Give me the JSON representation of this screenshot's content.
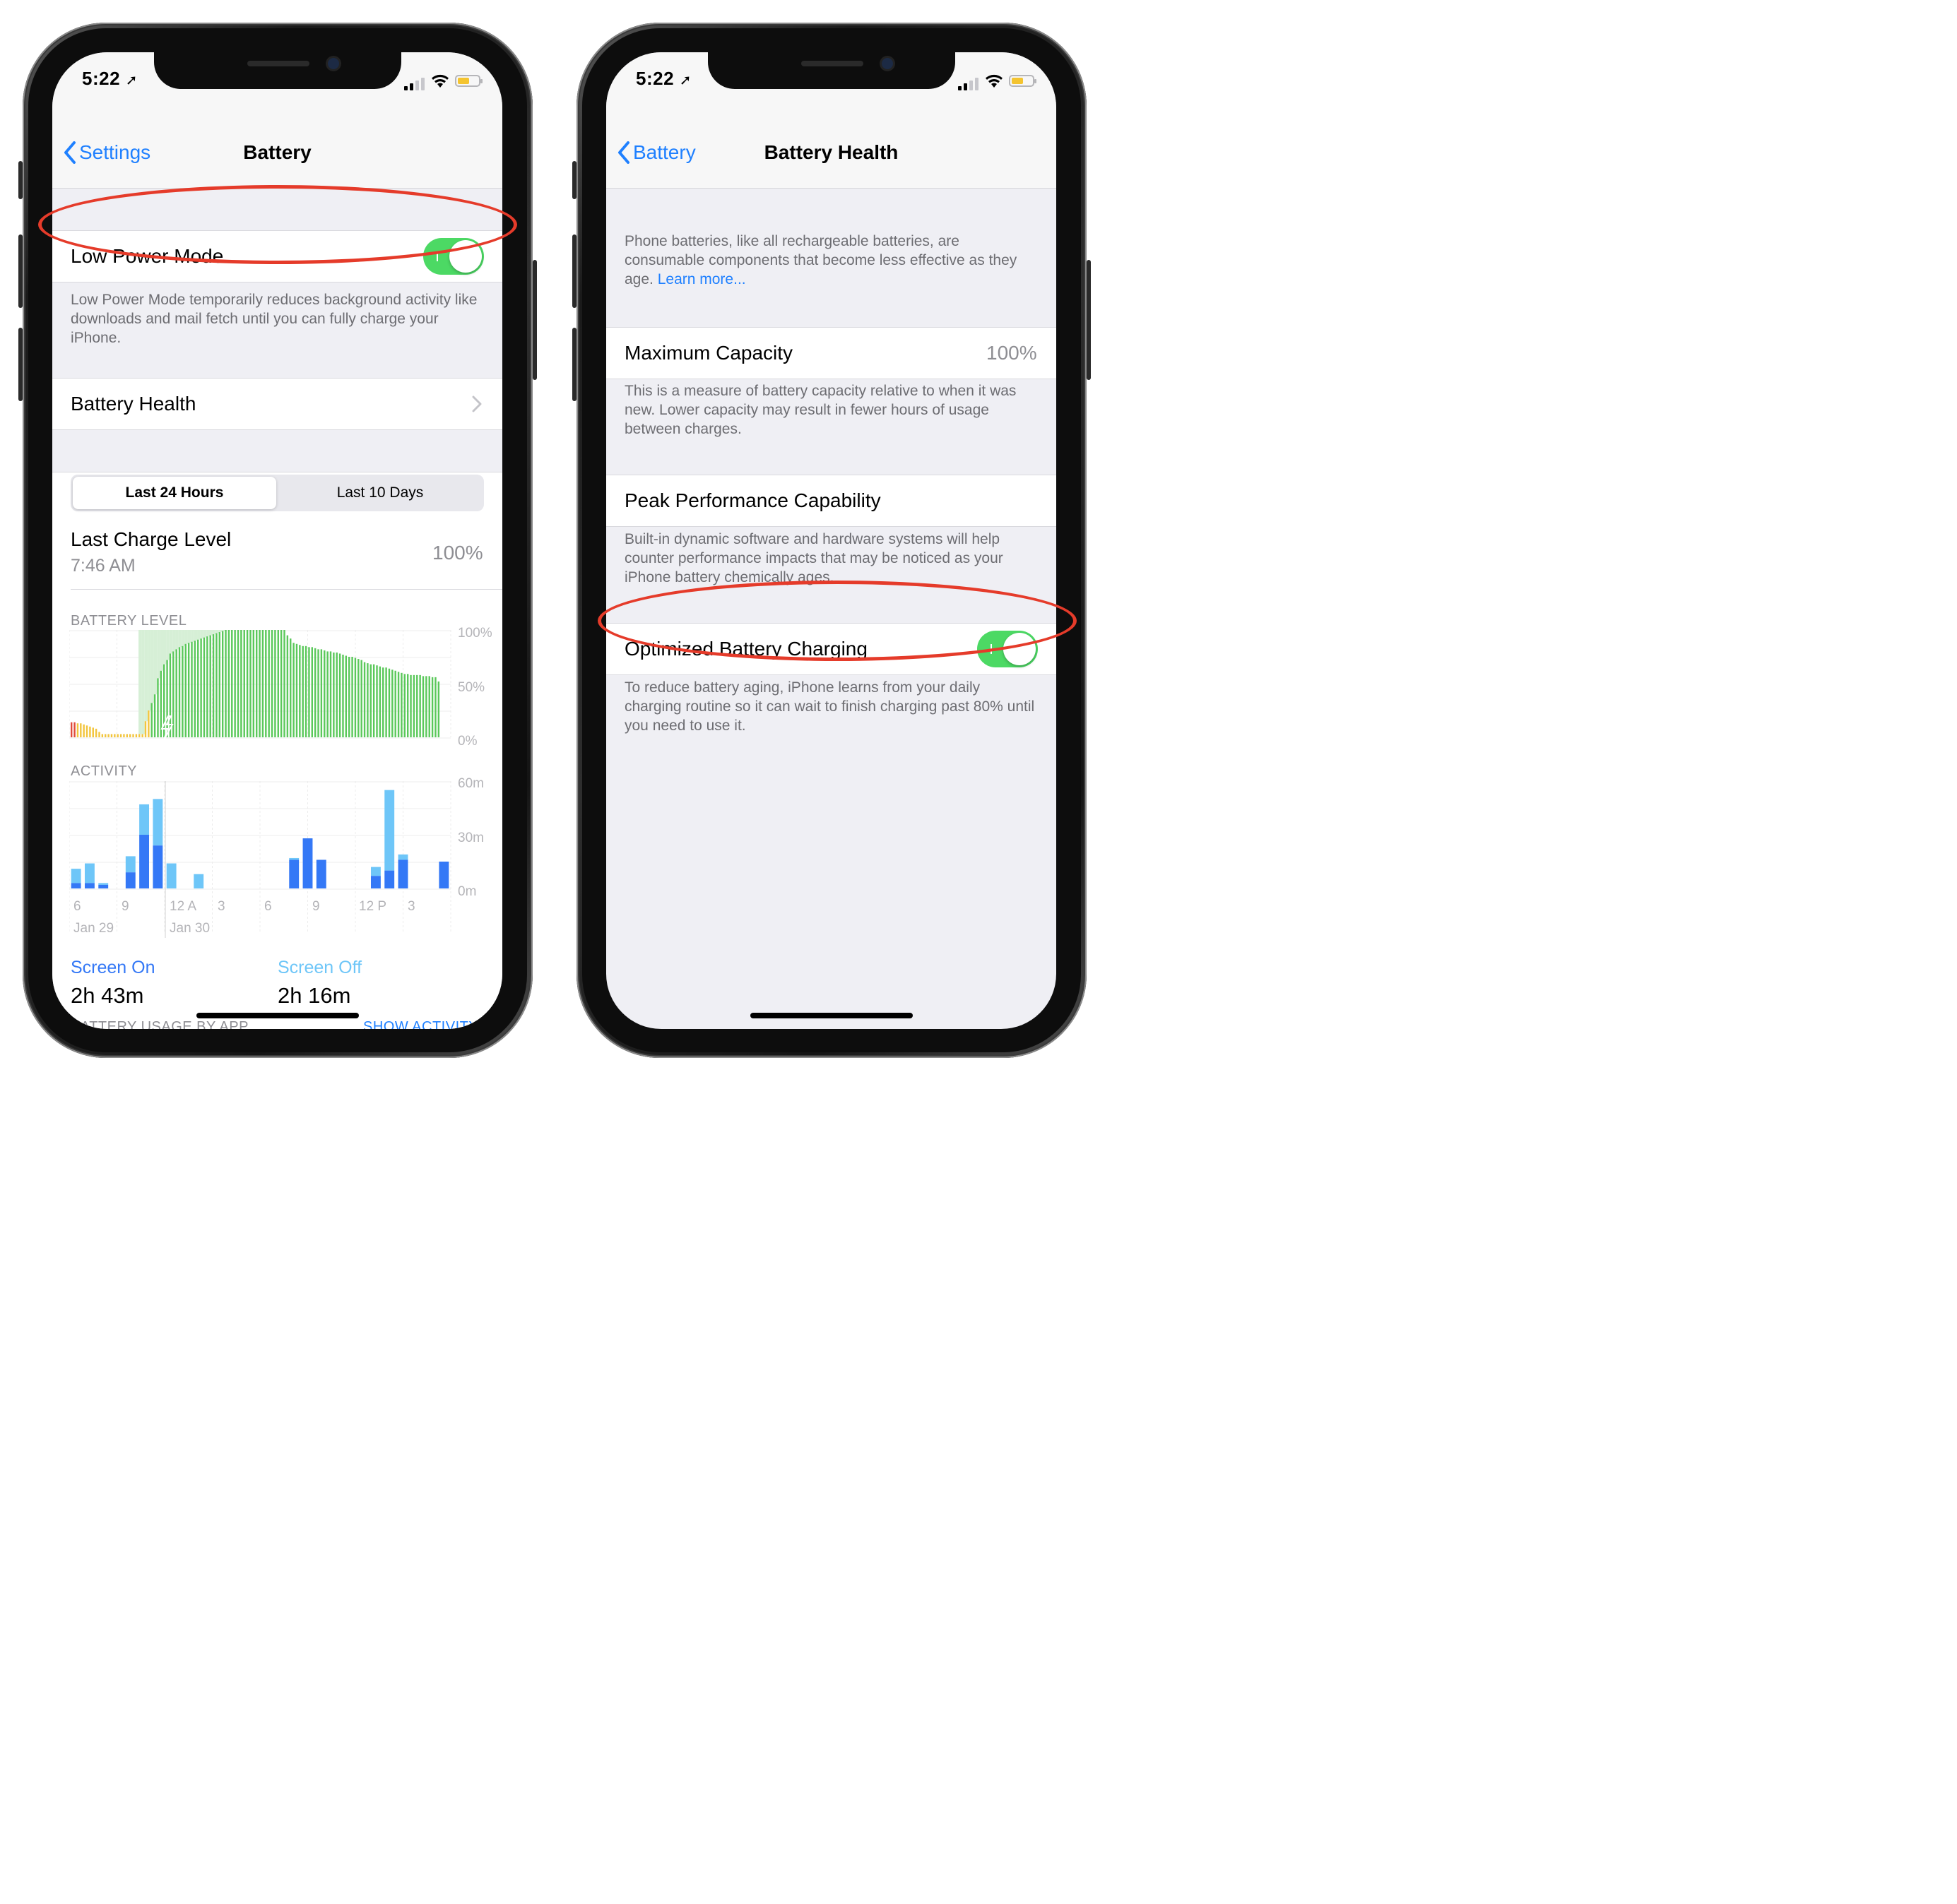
{
  "status": {
    "time": "5:22"
  },
  "colors": {
    "accent": "#1f80ff",
    "toggle_on": "#4cd964",
    "annotation": "#e53b2a",
    "screen_on": "#3478f6",
    "screen_off": "#6ec6f8",
    "battery_green": "#5ac85a",
    "battery_yellow": "#f2c53d",
    "battery_red": "#e04a3a"
  },
  "left": {
    "back_label": "Settings",
    "title": "Battery",
    "low_power": {
      "label": "Low Power Mode",
      "enabled": true,
      "footnote": "Low Power Mode temporarily reduces background activity like downloads and mail fetch until you can fully charge your iPhone."
    },
    "battery_health_label": "Battery Health",
    "segments": [
      "Last 24 Hours",
      "Last 10 Days"
    ],
    "last_charge": {
      "label": "Last Charge Level",
      "time": "7:46 AM",
      "value": "100%"
    },
    "battery_level_title": "BATTERY LEVEL",
    "battery_axis": [
      "100%",
      "50%",
      "0%"
    ],
    "activity_title": "ACTIVITY",
    "activity_axis": [
      "60m",
      "30m",
      "0m"
    ],
    "x_ticks": [
      "6",
      "9",
      "12 A",
      "3",
      "6",
      "9",
      "12 P",
      "3"
    ],
    "x_dates": [
      "Jan 29",
      "Jan 30"
    ],
    "screen_on": {
      "label": "Screen On",
      "value": "2h 43m"
    },
    "screen_off": {
      "label": "Screen Off",
      "value": "2h 16m"
    },
    "usage_header": "BATTERY USAGE BY APP",
    "show_activity": "SHOW ACTIVITY"
  },
  "right": {
    "back_label": "Battery",
    "title": "Battery Health",
    "intro": "Phone batteries, like all rechargeable batteries, are consumable components that become less effective as they age.",
    "learn_more": "Learn more...",
    "max_capacity": {
      "label": "Maximum Capacity",
      "value": "100%",
      "footnote": "This is a measure of battery capacity relative to when it was new. Lower capacity may result in fewer hours of usage between charges."
    },
    "peak": {
      "label": "Peak Performance Capability",
      "footnote": "Built-in dynamic software and hardware systems will help counter performance impacts that may be noticed as your iPhone battery chemically ages."
    },
    "optimized": {
      "label": "Optimized Battery Charging",
      "enabled": true,
      "footnote": "To reduce battery aging, iPhone learns from your daily charging routine so it can wait to finish charging past 80% until you need to use it."
    }
  },
  "chart_data": [
    {
      "type": "bar",
      "title": "BATTERY LEVEL",
      "ylabel": "",
      "ylim": [
        0,
        100
      ],
      "y_ticks": [
        "0%",
        "50%",
        "100%"
      ],
      "x_ticks": [
        "6",
        "9",
        "12 A",
        "3",
        "6",
        "9",
        "12 P",
        "3"
      ],
      "x_dates": [
        "Jan 29",
        "Jan 30"
      ],
      "series": [
        {
          "values": [
            14,
            14,
            13,
            13,
            12,
            11,
            10,
            9,
            8,
            5,
            3,
            3,
            3,
            3,
            3,
            3,
            3,
            3,
            3,
            3,
            3,
            3,
            3,
            3,
            15,
            25,
            32,
            40,
            55,
            62,
            68,
            72,
            78,
            80,
            82,
            84,
            85,
            87,
            88,
            89,
            90,
            91,
            92,
            93,
            94,
            95,
            96,
            97,
            98,
            99,
            100,
            100,
            100,
            100,
            100,
            100,
            100,
            100,
            100,
            100,
            100,
            100,
            100,
            100,
            100,
            100,
            100,
            100,
            100,
            100,
            95,
            92,
            88,
            87,
            86,
            85,
            85,
            84,
            84,
            83,
            82,
            82,
            81,
            80,
            80,
            79,
            79,
            78,
            77,
            76,
            75,
            75,
            74,
            73,
            72,
            70,
            69,
            68,
            68,
            67,
            66,
            65,
            65,
            64,
            63,
            62,
            61,
            60,
            59,
            59,
            58,
            58,
            58,
            58,
            57,
            57,
            57,
            56,
            56,
            52
          ]
        }
      ]
    },
    {
      "type": "bar",
      "title": "ACTIVITY",
      "ylabel": "",
      "ylim": [
        0,
        60
      ],
      "y_ticks": [
        "0m",
        "30m",
        "60m"
      ],
      "x_ticks": [
        "6",
        "9",
        "12 A",
        "3",
        "6",
        "9",
        "12 P",
        "3"
      ],
      "x_dates": [
        "Jan 29",
        "Jan 30"
      ],
      "series": [
        {
          "name": "Screen On",
          "values": [
            3,
            3,
            2,
            0,
            9,
            30,
            24,
            0,
            0,
            0,
            0,
            0,
            0,
            0,
            0,
            0,
            16,
            28,
            16,
            0,
            0,
            0,
            7,
            10,
            16,
            0,
            0,
            15
          ]
        },
        {
          "name": "Screen Off",
          "values": [
            8,
            11,
            1,
            0,
            9,
            17,
            26,
            14,
            0,
            8,
            0,
            0,
            0,
            0,
            0,
            0,
            1,
            0,
            0,
            0,
            0,
            0,
            5,
            45,
            3,
            0,
            0,
            0
          ]
        }
      ]
    }
  ]
}
